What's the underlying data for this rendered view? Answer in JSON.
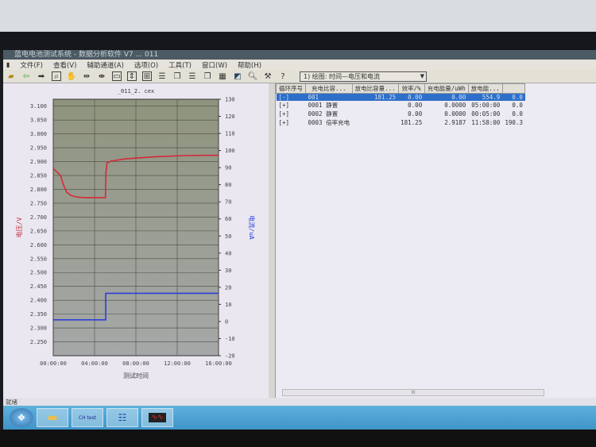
{
  "window": {
    "title": "蓝电电池测试系统 - 数据分析软件 V7 ... 011"
  },
  "menu": [
    "文件(F)",
    "查看(V)",
    "辅助通道(A)",
    "选项(O)",
    "工具(T)",
    "窗口(W)",
    "帮助(H)"
  ],
  "toolbar": {
    "view_select": "1) 绘图: 时间—电压和电流"
  },
  "chart_data": {
    "type": "line",
    "title": "_011_2. cex",
    "xlabel": "测试时间",
    "ylabel": "电压/V",
    "y2label": "电流/uA",
    "xlim": [
      0,
      16
    ],
    "ylim": [
      2.2,
      3.125
    ],
    "y2lim": [
      -20,
      130
    ],
    "xticks": [
      "00:00:00",
      "04:00:00",
      "08:00:00",
      "12:00:00",
      "16:00:00"
    ],
    "xtick_values": [
      0,
      4,
      8,
      12,
      16
    ],
    "yticks": [
      "3.100",
      "3.050",
      "3.000",
      "2.950",
      "2.900",
      "2.850",
      "2.800",
      "2.750",
      "2.700",
      "2.650",
      "2.600",
      "2.550",
      "2.500",
      "2.450",
      "2.400",
      "2.350",
      "2.300",
      "2.250"
    ],
    "y2ticks": [
      "130",
      "120",
      "110",
      "100",
      "90",
      "80",
      "70",
      "60",
      "50",
      "40",
      "30",
      "20",
      "10",
      "0",
      "-10",
      "-20"
    ],
    "grid": true,
    "series": [
      {
        "name": "电压",
        "axis": "left",
        "color": "#d42a3a",
        "x": [
          0,
          0.3,
          0.7,
          1.0,
          1.3,
          1.7,
          2.3,
          3,
          5.05,
          5.1,
          5.2,
          5.6,
          7,
          10,
          13,
          16
        ],
        "y": [
          2.875,
          2.865,
          2.85,
          2.815,
          2.79,
          2.778,
          2.772,
          2.77,
          2.77,
          2.86,
          2.895,
          2.902,
          2.91,
          2.918,
          2.922,
          2.923
        ]
      },
      {
        "name": "电流",
        "axis": "right",
        "color": "#2b3fd8",
        "x": [
          0,
          5.08,
          5.08,
          16
        ],
        "y": [
          1,
          1,
          16.5,
          16.5
        ]
      }
    ]
  },
  "table": {
    "headers": [
      "循环序号",
      "充电比容...",
      "放电比容量...",
      "效率/%",
      "充电能量/uWh",
      "放电能...",
      ""
    ],
    "rows": [
      {
        "cells": [
          "[-]",
          "001",
          "181.25",
          "0.00",
          "0.00",
          "554.9",
          "0.0"
        ],
        "selected": true
      },
      {
        "cells": [
          "[+]",
          "0001 静置",
          "",
          "0.00",
          "0.0000",
          "05:00:00",
          "0.0"
        ]
      },
      {
        "cells": [
          "[+]",
          "0002 静置",
          "",
          "0.00",
          "0.0000",
          "00:05:00",
          "0.0"
        ]
      },
      {
        "cells": [
          "[+]",
          "0003 倍率充电",
          "",
          "181.25",
          "2.9187",
          "11:58:00",
          "190.3"
        ]
      }
    ]
  },
  "scroll_label": "III",
  "status": "就绪",
  "taskbar": {
    "app_label": "CH test"
  }
}
